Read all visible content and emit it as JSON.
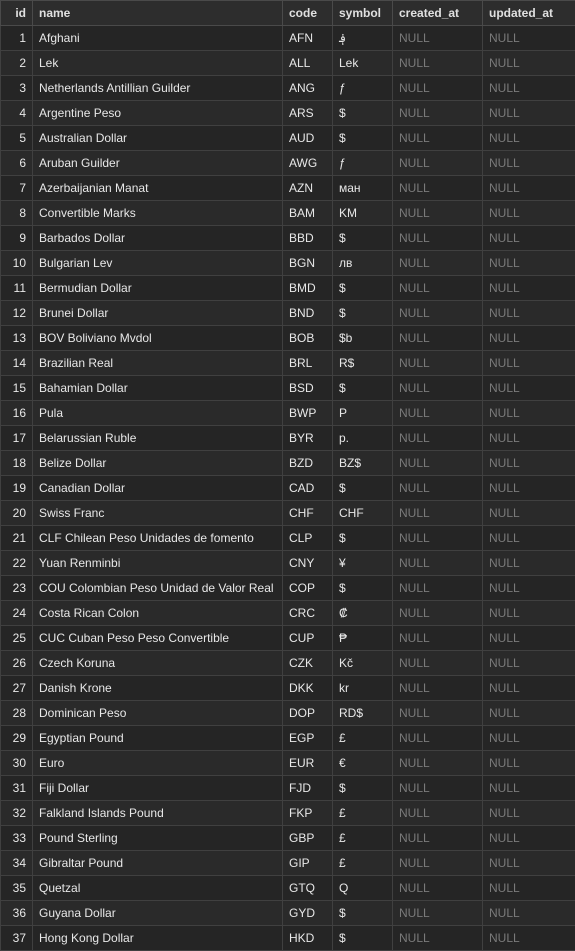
{
  "columns": [
    "id",
    "name",
    "code",
    "symbol",
    "created_at",
    "updated_at"
  ],
  "null_label": "NULL",
  "rows": [
    {
      "id": 1,
      "name": "Afghani",
      "code": "AFN",
      "symbol": "؋",
      "created_at": null,
      "updated_at": null
    },
    {
      "id": 2,
      "name": "Lek",
      "code": "ALL",
      "symbol": "Lek",
      "created_at": null,
      "updated_at": null
    },
    {
      "id": 3,
      "name": "Netherlands Antillian Guilder",
      "code": "ANG",
      "symbol": "ƒ",
      "created_at": null,
      "updated_at": null
    },
    {
      "id": 4,
      "name": "Argentine Peso",
      "code": "ARS",
      "symbol": "$",
      "created_at": null,
      "updated_at": null
    },
    {
      "id": 5,
      "name": "Australian Dollar",
      "code": "AUD",
      "symbol": "$",
      "created_at": null,
      "updated_at": null
    },
    {
      "id": 6,
      "name": "Aruban Guilder",
      "code": "AWG",
      "symbol": "ƒ",
      "created_at": null,
      "updated_at": null
    },
    {
      "id": 7,
      "name": "Azerbaijanian Manat",
      "code": "AZN",
      "symbol": "ман",
      "created_at": null,
      "updated_at": null
    },
    {
      "id": 8,
      "name": "Convertible Marks",
      "code": "BAM",
      "symbol": "KM",
      "created_at": null,
      "updated_at": null
    },
    {
      "id": 9,
      "name": "Barbados Dollar",
      "code": "BBD",
      "symbol": "$",
      "created_at": null,
      "updated_at": null
    },
    {
      "id": 10,
      "name": "Bulgarian Lev",
      "code": "BGN",
      "symbol": "лв",
      "created_at": null,
      "updated_at": null
    },
    {
      "id": 11,
      "name": "Bermudian Dollar",
      "code": "BMD",
      "symbol": "$",
      "created_at": null,
      "updated_at": null
    },
    {
      "id": 12,
      "name": "Brunei Dollar",
      "code": "BND",
      "symbol": "$",
      "created_at": null,
      "updated_at": null
    },
    {
      "id": 13,
      "name": "BOV Boliviano Mvdol",
      "code": "BOB",
      "symbol": "$b",
      "created_at": null,
      "updated_at": null
    },
    {
      "id": 14,
      "name": "Brazilian Real",
      "code": "BRL",
      "symbol": "R$",
      "created_at": null,
      "updated_at": null
    },
    {
      "id": 15,
      "name": "Bahamian Dollar",
      "code": "BSD",
      "symbol": "$",
      "created_at": null,
      "updated_at": null
    },
    {
      "id": 16,
      "name": "Pula",
      "code": "BWP",
      "symbol": "P",
      "created_at": null,
      "updated_at": null
    },
    {
      "id": 17,
      "name": "Belarussian Ruble",
      "code": "BYR",
      "symbol": "p.",
      "created_at": null,
      "updated_at": null
    },
    {
      "id": 18,
      "name": "Belize Dollar",
      "code": "BZD",
      "symbol": "BZ$",
      "created_at": null,
      "updated_at": null
    },
    {
      "id": 19,
      "name": "Canadian Dollar",
      "code": "CAD",
      "symbol": "$",
      "created_at": null,
      "updated_at": null
    },
    {
      "id": 20,
      "name": "Swiss Franc",
      "code": "CHF",
      "symbol": "CHF",
      "created_at": null,
      "updated_at": null
    },
    {
      "id": 21,
      "name": "CLF Chilean Peso Unidades de fomento",
      "code": "CLP",
      "symbol": "$",
      "created_at": null,
      "updated_at": null
    },
    {
      "id": 22,
      "name": "Yuan Renminbi",
      "code": "CNY",
      "symbol": "¥",
      "created_at": null,
      "updated_at": null
    },
    {
      "id": 23,
      "name": "COU Colombian Peso Unidad de Valor Real",
      "code": "COP",
      "symbol": "$",
      "created_at": null,
      "updated_at": null
    },
    {
      "id": 24,
      "name": "Costa Rican Colon",
      "code": "CRC",
      "symbol": "₡",
      "created_at": null,
      "updated_at": null
    },
    {
      "id": 25,
      "name": "CUC Cuban Peso Peso Convertible",
      "code": "CUP",
      "symbol": "₱",
      "created_at": null,
      "updated_at": null
    },
    {
      "id": 26,
      "name": "Czech Koruna",
      "code": "CZK",
      "symbol": "Kč",
      "created_at": null,
      "updated_at": null
    },
    {
      "id": 27,
      "name": "Danish Krone",
      "code": "DKK",
      "symbol": "kr",
      "created_at": null,
      "updated_at": null
    },
    {
      "id": 28,
      "name": "Dominican Peso",
      "code": "DOP",
      "symbol": "RD$",
      "created_at": null,
      "updated_at": null
    },
    {
      "id": 29,
      "name": "Egyptian Pound",
      "code": "EGP",
      "symbol": "£",
      "created_at": null,
      "updated_at": null
    },
    {
      "id": 30,
      "name": "Euro",
      "code": "EUR",
      "symbol": "€",
      "created_at": null,
      "updated_at": null
    },
    {
      "id": 31,
      "name": "Fiji Dollar",
      "code": "FJD",
      "symbol": "$",
      "created_at": null,
      "updated_at": null
    },
    {
      "id": 32,
      "name": "Falkland Islands Pound",
      "code": "FKP",
      "symbol": "£",
      "created_at": null,
      "updated_at": null
    },
    {
      "id": 33,
      "name": "Pound Sterling",
      "code": "GBP",
      "symbol": "£",
      "created_at": null,
      "updated_at": null
    },
    {
      "id": 34,
      "name": "Gibraltar Pound",
      "code": "GIP",
      "symbol": "£",
      "created_at": null,
      "updated_at": null
    },
    {
      "id": 35,
      "name": "Quetzal",
      "code": "GTQ",
      "symbol": "Q",
      "created_at": null,
      "updated_at": null
    },
    {
      "id": 36,
      "name": "Guyana Dollar",
      "code": "GYD",
      "symbol": "$",
      "created_at": null,
      "updated_at": null
    },
    {
      "id": 37,
      "name": "Hong Kong Dollar",
      "code": "HKD",
      "symbol": "$",
      "created_at": null,
      "updated_at": null
    }
  ]
}
